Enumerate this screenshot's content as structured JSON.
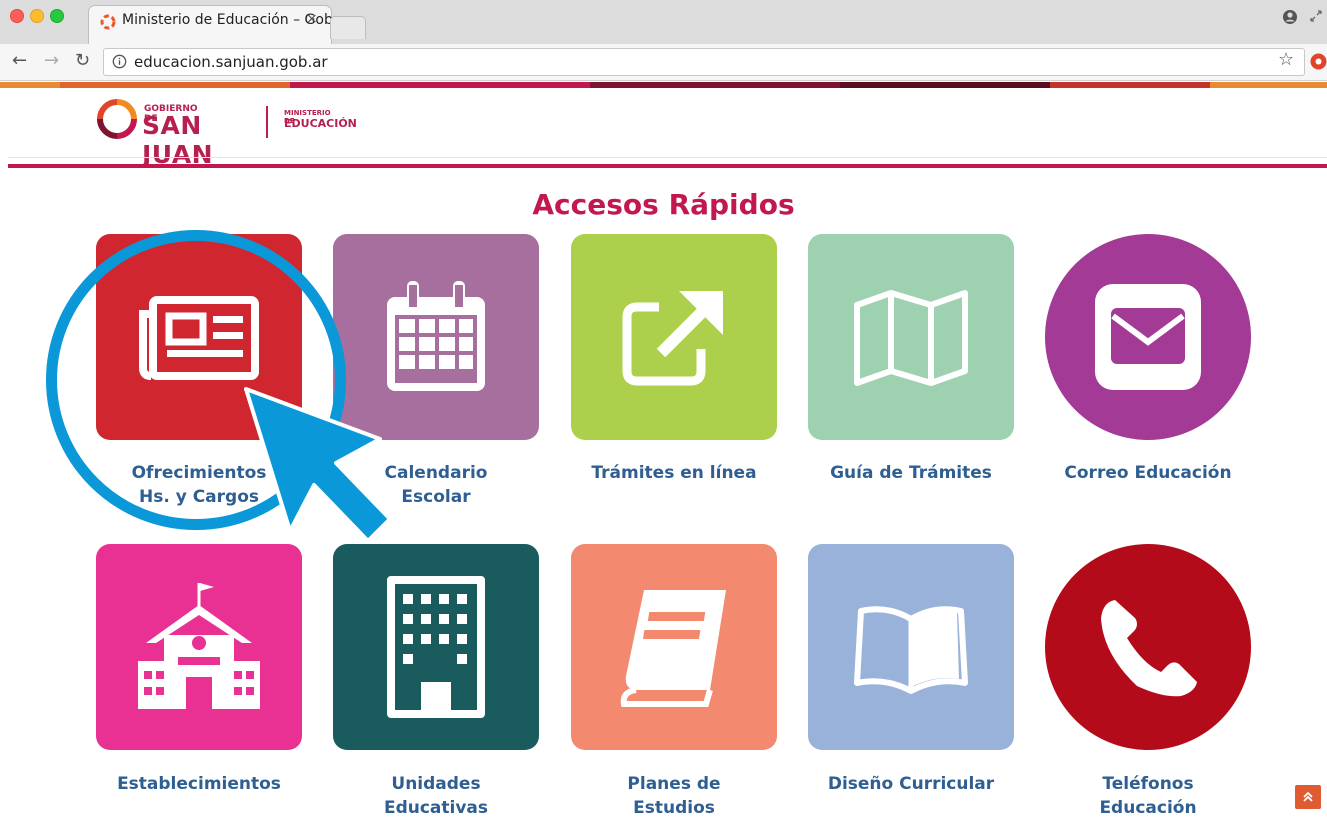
{
  "browser": {
    "tab_title": "Ministerio de Educación – Gob",
    "tab_close": "×",
    "url": "educacion.sanjuan.gob.ar"
  },
  "header": {
    "gob_small": "GOBIERNO DE",
    "gob_big": "SAN JUAN",
    "min_small": "MINISTERIO DE",
    "min_big": "EDUCACIÓN"
  },
  "page": {
    "section_title": "Accesos Rápidos"
  },
  "tiles": [
    {
      "label": "Ofrecimientos\nHs. y Cargos",
      "color": "#cf2630",
      "icon": "newspaper-icon"
    },
    {
      "label": "Calendario\nEscolar",
      "color": "#a66f9d",
      "icon": "calendar-icon"
    },
    {
      "label": "Trámites en línea",
      "color": "#acd04b",
      "icon": "external-link-icon"
    },
    {
      "label": "Guía de Trámites",
      "color": "#9ed1b0",
      "icon": "map-icon"
    },
    {
      "label": "Correo Educación",
      "color": "#a33a95",
      "icon": "envelope-icon"
    },
    {
      "label": "Establecimientos",
      "color": "#e93194",
      "icon": "school-icon"
    },
    {
      "label": "Unidades\nEducativas",
      "color": "#1a5c5d",
      "icon": "building-icon"
    },
    {
      "label": "Planes de\nEstudios",
      "color": "#f38a70",
      "icon": "book-icon"
    },
    {
      "label": "Diseño Curricular",
      "color": "#98b2da",
      "icon": "open-book-icon"
    },
    {
      "label": "Teléfonos\nEducación",
      "color": "#b30b1a",
      "icon": "phone-icon"
    }
  ],
  "colors": {
    "brand": "#c2184e",
    "link": "#2f5f92",
    "overlay": "#0b98d9"
  }
}
